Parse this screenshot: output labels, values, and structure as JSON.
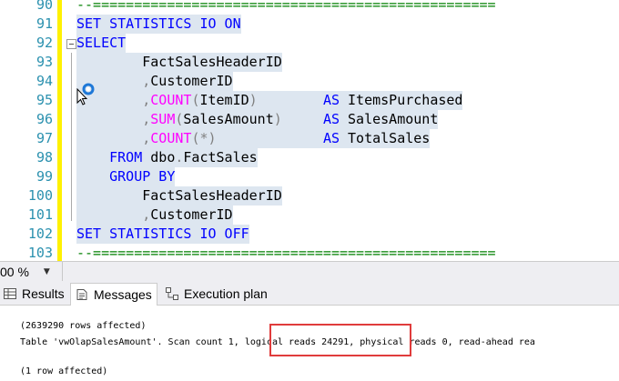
{
  "editor": {
    "lines": [
      {
        "num": "90",
        "segments": [
          {
            "t": "--=================================================",
            "c": "cm"
          }
        ]
      },
      {
        "num": "91",
        "segments": [
          {
            "t": "SET STATISTICS IO ON",
            "c": "kw"
          }
        ]
      },
      {
        "num": "92",
        "segments": [
          {
            "t": "SELECT",
            "c": "kw"
          }
        ]
      },
      {
        "num": "93",
        "segments": [
          {
            "t": "        FactSalesHeaderID",
            "c": ""
          }
        ]
      },
      {
        "num": "94",
        "segments": [
          {
            "t": "        ",
            "c": ""
          },
          {
            "t": ",",
            "c": "gr"
          },
          {
            "t": "CustomerID",
            "c": ""
          }
        ]
      },
      {
        "num": "95",
        "segments": [
          {
            "t": "        ",
            "c": ""
          },
          {
            "t": ",",
            "c": "gr"
          },
          {
            "t": "COUNT",
            "c": "fn"
          },
          {
            "t": "(",
            "c": "gr"
          },
          {
            "t": "ItemID",
            "c": ""
          },
          {
            "t": ")",
            "c": "gr"
          },
          {
            "t": "        ",
            "c": ""
          },
          {
            "t": "AS",
            "c": "kw"
          },
          {
            "t": " ItemsPurchased",
            "c": ""
          }
        ]
      },
      {
        "num": "96",
        "segments": [
          {
            "t": "        ",
            "c": ""
          },
          {
            "t": ",",
            "c": "gr"
          },
          {
            "t": "SUM",
            "c": "fn"
          },
          {
            "t": "(",
            "c": "gr"
          },
          {
            "t": "SalesAmount",
            "c": ""
          },
          {
            "t": ")",
            "c": "gr"
          },
          {
            "t": "     ",
            "c": ""
          },
          {
            "t": "AS",
            "c": "kw"
          },
          {
            "t": " SalesAmount",
            "c": ""
          }
        ]
      },
      {
        "num": "97",
        "segments": [
          {
            "t": "        ",
            "c": ""
          },
          {
            "t": ",",
            "c": "gr"
          },
          {
            "t": "COUNT",
            "c": "fn"
          },
          {
            "t": "(*)",
            "c": "gr"
          },
          {
            "t": "             ",
            "c": ""
          },
          {
            "t": "AS",
            "c": "kw"
          },
          {
            "t": " TotalSales",
            "c": ""
          }
        ]
      },
      {
        "num": "98",
        "segments": [
          {
            "t": "    ",
            "c": ""
          },
          {
            "t": "FROM",
            "c": "kw"
          },
          {
            "t": " dbo",
            "c": ""
          },
          {
            "t": ".",
            "c": "gr"
          },
          {
            "t": "FactSales",
            "c": ""
          }
        ]
      },
      {
        "num": "99",
        "segments": [
          {
            "t": "    ",
            "c": ""
          },
          {
            "t": "GROUP BY",
            "c": "kw"
          }
        ]
      },
      {
        "num": "100",
        "segments": [
          {
            "t": "        FactSalesHeaderID",
            "c": ""
          }
        ]
      },
      {
        "num": "101",
        "segments": [
          {
            "t": "        ",
            "c": ""
          },
          {
            "t": ",",
            "c": "gr"
          },
          {
            "t": "CustomerID",
            "c": ""
          }
        ]
      },
      {
        "num": "102",
        "segments": [
          {
            "t": "SET STATISTICS IO OFF",
            "c": "kw"
          }
        ]
      },
      {
        "num": "103",
        "segments": [
          {
            "t": "--=================================================",
            "c": "cm"
          }
        ]
      }
    ]
  },
  "zoom": {
    "value": "00 %"
  },
  "tabs": [
    {
      "label": "Results",
      "icon": "grid-icon",
      "active": false
    },
    {
      "label": "Messages",
      "icon": "messages-icon",
      "active": true
    },
    {
      "label": "Execution plan",
      "icon": "execution-plan-icon",
      "active": false
    }
  ],
  "messages": {
    "line1": "(2639290 rows affected)",
    "line2": "Table 'vwOlapSalesAmount'. Scan count 1, logical reads 24291, physical reads 0, read-ahead rea",
    "line3": "(1 row affected)"
  },
  "colors": {
    "highlight": "#e03c3c",
    "keyword": "#0000ff",
    "function": "#ff00ff",
    "line_number": "#2b91af",
    "selection": "#dde6f0"
  }
}
